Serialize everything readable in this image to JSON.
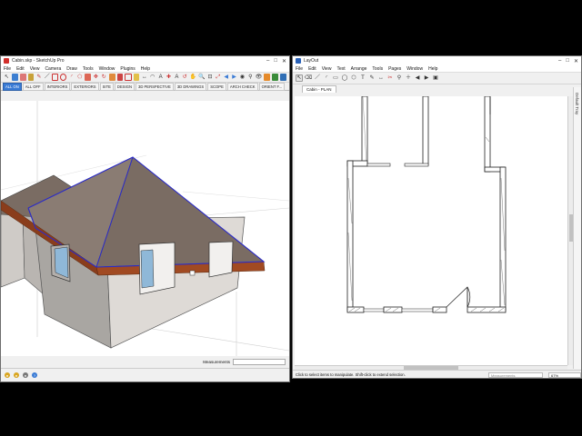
{
  "sketchup": {
    "title": "Cabin.skp - SketchUp Pro",
    "menus": [
      "File",
      "Edit",
      "View",
      "Camera",
      "Draw",
      "Tools",
      "Window",
      "Plugins",
      "Help"
    ],
    "scenes": [
      "ALL ON",
      "ALL OFF",
      "INTERIORS",
      "EXTERIORS",
      "SITE",
      "DESIGN",
      "3D PERSPECTIVE",
      "3D DRAWINGS",
      "SCOPE",
      "ARCH CHECK",
      "ORIENT F..."
    ],
    "active_scene": "ALL ON",
    "measurements_label": "Measurements",
    "roof_color": "#7a6c63",
    "fascia_color": "#a14a22",
    "edge_highlight": "#2b2bc8"
  },
  "layout": {
    "title": "LayOut",
    "menus": [
      "File",
      "Edit",
      "View",
      "Text",
      "Arrange",
      "Tools",
      "Pages",
      "Window",
      "Help"
    ],
    "tab_label": "Cabin - PLAN",
    "side_panel_label": "Default Tray",
    "status_text": "Click to select items to manipulate. Shift-click to extend selection.",
    "measurements_label": "Measurements",
    "zoom": "67%"
  }
}
